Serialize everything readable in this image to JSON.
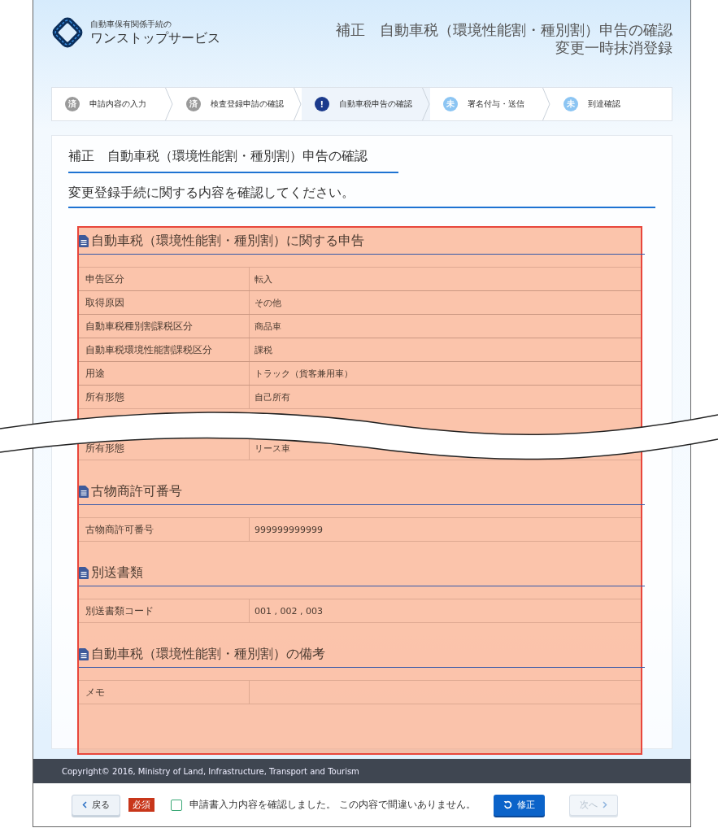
{
  "header": {
    "logo_caption": "自動車保有関係手続の",
    "logo_title": "ワンストップサービス",
    "title_lines": [
      "補正　自動車税（環境性能割・種別割）申告の確認",
      "変更一時抹消登録"
    ]
  },
  "steps": [
    {
      "badge": "済",
      "label": "申請内容の入力",
      "kind": "done"
    },
    {
      "badge": "済",
      "label": "検査登録申請の確認",
      "kind": "done"
    },
    {
      "badge": "!",
      "label": "自動車税申告の確認",
      "kind": "current"
    },
    {
      "badge": "未",
      "label": "署名付与・送信",
      "kind": "todo"
    },
    {
      "badge": "未",
      "label": "到達確認",
      "kind": "todo"
    }
  ],
  "panel": {
    "title": "補正　自動車税（環境性能割・種別割）申告の確認",
    "instruction": "変更登録手続に関する内容を確認してください。"
  },
  "sections": [
    {
      "title": "自動車税（環境性能割・種別割）に関する申告",
      "rows": [
        {
          "kind": "row",
          "label": "申告区分",
          "value": "転入"
        },
        {
          "kind": "row",
          "label": "取得原因",
          "value": "その他"
        },
        {
          "kind": "row",
          "label": "自動車税種別割課税区分",
          "value": "商品車"
        },
        {
          "kind": "row",
          "label": "自動車税環境性能割課税区分",
          "value": "課税"
        },
        {
          "kind": "row",
          "label": "用途",
          "value": "トラック（貨客兼用車）"
        },
        {
          "kind": "row",
          "label": "所有形態",
          "value": "自己所有"
        },
        {
          "kind": "break"
        },
        {
          "kind": "row",
          "label": "所有形態",
          "value": "リース車"
        }
      ]
    },
    {
      "title": "古物商許可番号",
      "rows": [
        {
          "kind": "row",
          "label": "古物商許可番号",
          "value": "999999999999"
        }
      ]
    },
    {
      "title": "別送書類",
      "rows": [
        {
          "kind": "row",
          "label": "別送書類コード",
          "value": "001 , 002 , 003"
        }
      ]
    },
    {
      "title": "自動車税（環境性能割・種別割）の備考",
      "rows": [
        {
          "kind": "row",
          "label": "メモ"
        }
      ]
    }
  ],
  "footer": {
    "copyright": "Copyright© 2016, Ministry of Land, Infrastructure, Transport and Tourism"
  },
  "actions": {
    "back": "戻る",
    "required": "必須",
    "confirm": {
      "label": "申請書入力内容を確認しました。 この内容で間違いありません。",
      "checked": false
    },
    "fix": "修正",
    "next": {
      "label": "次へ",
      "disabled": true
    }
  }
}
